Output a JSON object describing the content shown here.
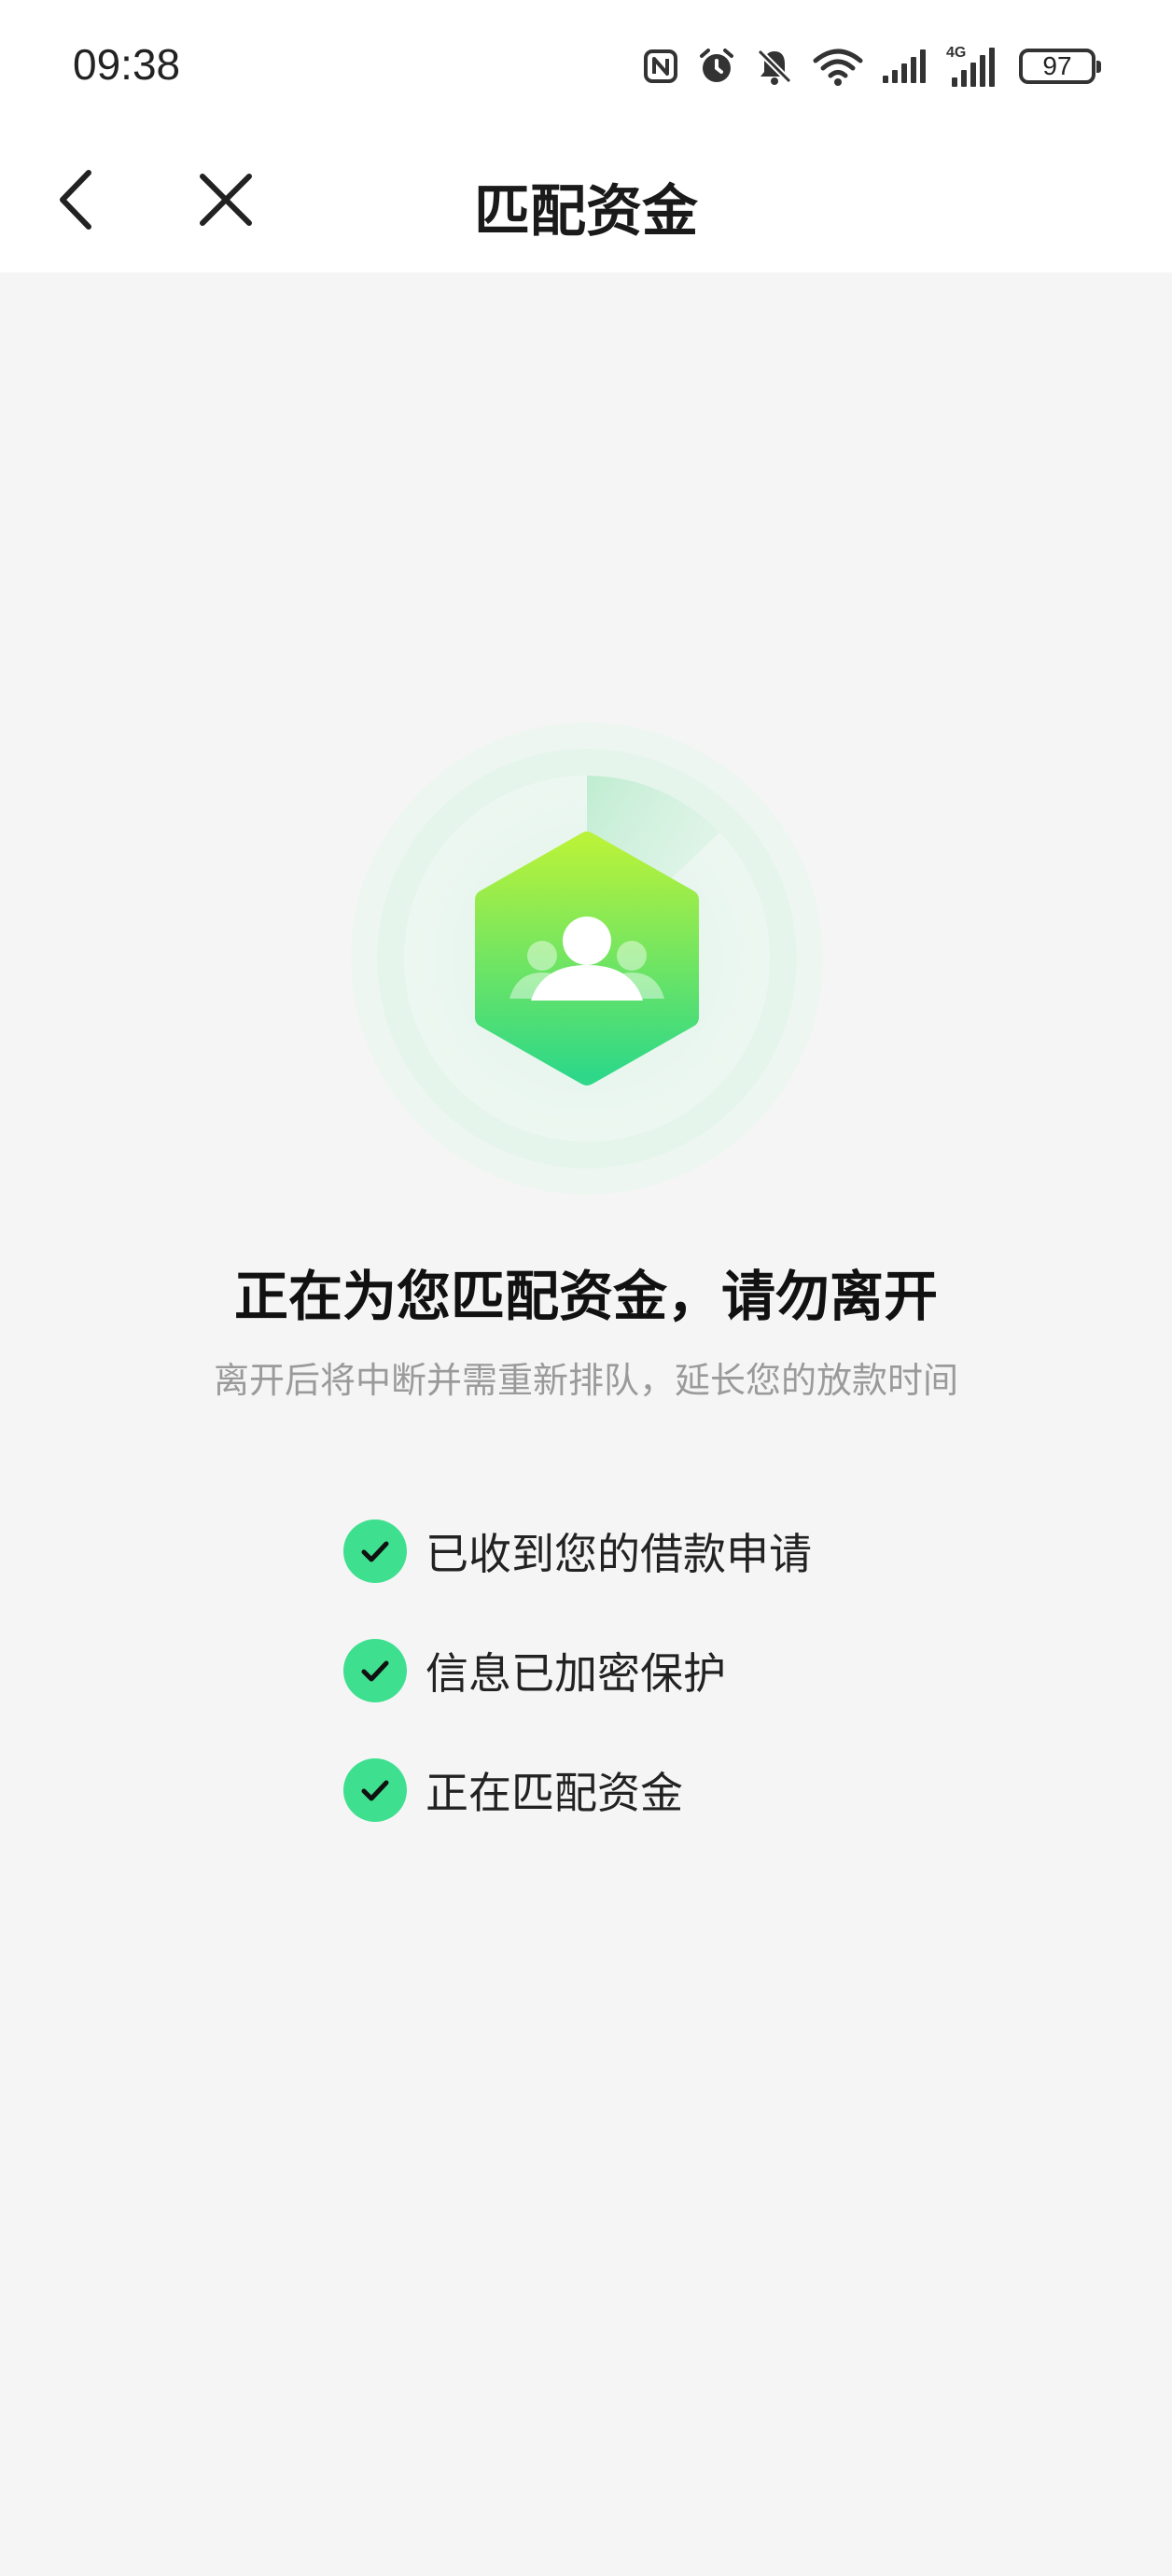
{
  "status_bar": {
    "time": "09:38",
    "battery": "97",
    "network": "4G",
    "icons": [
      "nfc-icon",
      "alarm-icon",
      "bell-muted-icon",
      "wifi-icon",
      "signal-icon",
      "signal-4g-icon",
      "battery-icon"
    ]
  },
  "nav": {
    "title": "匹配资金",
    "back_icon": "chevron-left-icon",
    "close_icon": "close-icon"
  },
  "main": {
    "headline": "正在为您匹配资金，请勿离开",
    "subline": "离开后将中断并需重新排队，延长您的放款时间",
    "illustration_icon": "users-hexagon-icon",
    "steps": [
      {
        "label": "已收到您的借款申请",
        "status": "done"
      },
      {
        "label": "信息已加密保护",
        "status": "done"
      },
      {
        "label": "正在匹配资金",
        "status": "done"
      }
    ]
  },
  "colors": {
    "accent_green": "#3ee08f",
    "accent_lime": "#b8f23a",
    "background": "#f5f5f5"
  }
}
